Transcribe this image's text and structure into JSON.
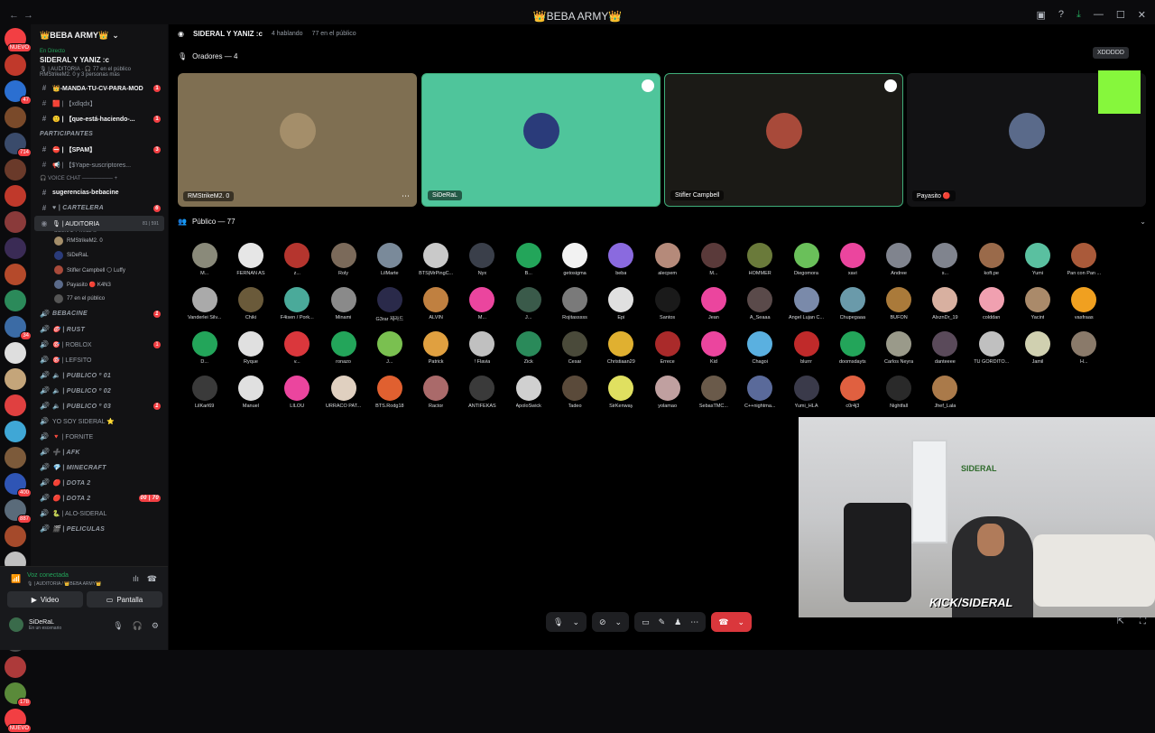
{
  "app": {
    "title": "👑BEBA ARMY👑"
  },
  "colors": {
    "accent": "#23a55a",
    "danger": "#da373c",
    "brand": "#5865f2"
  },
  "servers": [
    {
      "badge": "NUEVO",
      "color": "#f23f43"
    },
    {
      "badge": "",
      "color": "#c0392b"
    },
    {
      "badge": "47",
      "color": "#2b6fd1"
    },
    {
      "badge": "",
      "color": "#7a4a2a"
    },
    {
      "badge": "714",
      "color": "#3a4b6b"
    },
    {
      "badge": "",
      "color": "#6a3a2a"
    },
    {
      "badge": "",
      "color": "#c0392b"
    },
    {
      "badge": "",
      "color": "#8a3a3a"
    },
    {
      "badge": "",
      "color": "#3a2b55"
    },
    {
      "badge": "",
      "color": "#b54a2b"
    },
    {
      "badge": "",
      "color": "#2b8a5a"
    },
    {
      "badge": "34",
      "color": "#3b6ba5"
    },
    {
      "badge": "",
      "color": "#dedede"
    },
    {
      "badge": "",
      "color": "#c4a57a"
    },
    {
      "badge": "",
      "color": "#e04040"
    },
    {
      "badge": "",
      "color": "#3fa7d6"
    },
    {
      "badge": "",
      "color": "#7c5a3a"
    },
    {
      "badge": "400",
      "color": "#2f55b5"
    },
    {
      "badge": "887",
      "color": "#5a6b7a"
    },
    {
      "badge": "",
      "color": "#a54a2b"
    },
    {
      "badge": "",
      "color": "#c0c0c0"
    },
    {
      "badge": "173",
      "color": "#111"
    },
    {
      "badge": "",
      "color": "#e2a27a"
    },
    {
      "badge": "",
      "color": "#4a4a4a"
    },
    {
      "badge": "",
      "color": "#ad3a3a"
    },
    {
      "badge": "178",
      "color": "#5a8a3a"
    },
    {
      "badge": "NUEVO",
      "color": "#f23f43"
    }
  ],
  "sidebar": {
    "guild_name": "👑BEBA ARMY👑",
    "live": {
      "label": "En Directo",
      "title": "SIDERAL Y YANIZ :c",
      "meta": "🎙 | AUDITORIA · 🎧 77 en el público",
      "speakers": "RMStrikeM2. 0 y 3 personas más"
    },
    "channels": [
      {
        "icon": "#",
        "label": "👑-MANDA-TU-CV-PARA-MOD",
        "style": "bright",
        "count": "1"
      },
      {
        "icon": "#",
        "label": "🟥 | 【xdlqdx】",
        "style": "",
        "count": ""
      },
      {
        "icon": "#",
        "label": "🙂 | 【que-está-haciendo-...",
        "style": "bright",
        "count": "1"
      },
      {
        "icon": "",
        "label": "PARTICIPANTES",
        "style": "italic",
        "count": ""
      },
      {
        "icon": "#",
        "label": "⛔ | 【SPAM】",
        "style": "bright",
        "count": "3"
      },
      {
        "icon": "#",
        "label": "📢 | 【$Yape-suscriptores...",
        "style": "",
        "count": ""
      },
      {
        "icon": "",
        "label": "🎧 VOICE CHAT ──────── +",
        "style": "cat",
        "count": ""
      },
      {
        "icon": "#",
        "label": "sugerencias-bebacine",
        "style": "bright",
        "count": ""
      },
      {
        "icon": "#",
        "label": "♥ | CARTELERA",
        "style": "italic",
        "count": "6"
      }
    ],
    "active": {
      "label": "🎙 | AUDITORIA",
      "sub": "SIDERAL Y YANIZ :c",
      "meta": "81 | 591"
    },
    "stage_members": [
      "RMStrikeM2. 0",
      "SiDeRaL",
      "Stifler Campbell 🌕 Luffy",
      "Payasito 🔴 K4N3",
      "77 en el público"
    ],
    "channels2": [
      {
        "icon": "🔊",
        "label": "BEBACINE",
        "style": "italic",
        "count": "1"
      },
      {
        "icon": "🔊",
        "label": "🎯 | RUST",
        "style": "italic",
        "count": ""
      },
      {
        "icon": "🔊",
        "label": "🎯 | ROBLOX",
        "style": "",
        "count": "1"
      },
      {
        "icon": "🔊",
        "label": "🎯 | LEFSITO",
        "style": "",
        "count": ""
      },
      {
        "icon": "🔊",
        "label": "🔈 | PUBLICO º 01",
        "style": "italic",
        "count": ""
      },
      {
        "icon": "🔊",
        "label": "🔈 | PUBLICO º 02",
        "style": "italic",
        "count": ""
      },
      {
        "icon": "🔊",
        "label": "🔈 | PUBLICO º 03",
        "style": "italic",
        "count": "1"
      },
      {
        "icon": "🔊",
        "label": "YO SOY SIDERAL ⭐",
        "style": "",
        "count": ""
      },
      {
        "icon": "🔊",
        "label": "🔻 | FORNITE",
        "style": "",
        "count": ""
      },
      {
        "icon": "🔊",
        "label": "➕ | AFK",
        "style": "italic",
        "count": ""
      },
      {
        "icon": "🔊",
        "label": "💎 | MINECRAFT",
        "style": "italic",
        "count": ""
      },
      {
        "icon": "🔊",
        "label": "🔴 | DOTA 2",
        "style": "italic",
        "count": ""
      },
      {
        "icon": "🔊",
        "label": "🔴 | DOTA 2",
        "style": "italic",
        "count": "00 | 70"
      },
      {
        "icon": "🔊",
        "label": "🐍 | ALO-SIDERAL",
        "style": "",
        "count": ""
      },
      {
        "icon": "🔊",
        "label": "🎬 | PELICULAS",
        "style": "italic",
        "count": ""
      }
    ]
  },
  "voice": {
    "status": "Voz conectada",
    "location": "🎙 | AUDITORIA / 👑BEBA ARMY👑",
    "video_label": "Video",
    "screen_label": "Pantalla"
  },
  "user": {
    "name": "SiDeRaL",
    "status": "En un escenario"
  },
  "stage": {
    "title": "SIDERAL Y YANIZ :c",
    "speaking": "4 hablando",
    "audience_count": "77 en el público",
    "speakers_label": "Oradores — 4",
    "audience_label": "Público — 77",
    "speakers": [
      {
        "name": "RMStrikeM2. 0",
        "bg": "#7f6f52",
        "av": "#a48e6a"
      },
      {
        "name": "SiDeRaL",
        "bg": "#4fc59b",
        "av": "#2a3b7a"
      },
      {
        "name": "Stifler Campbell",
        "bg": "#1b1a16",
        "av": "#a84a3a"
      },
      {
        "name": "Payasito 🔴",
        "bg": "#121214",
        "av": "#5a6a8a"
      }
    ],
    "xd_label": "XDDDDD"
  },
  "audience": [
    {
      "n": "M...",
      "c": "#8a8a7a"
    },
    {
      "n": "FERNAN AS",
      "c": "#e6e6e6"
    },
    {
      "n": "z...",
      "c": "#b5352e"
    },
    {
      "n": "Roly",
      "c": "#7b6a5a"
    },
    {
      "n": "LilMarte",
      "c": "#7a8a9a"
    },
    {
      "n": "BTS|MrPingC...",
      "c": "#c9c9c9"
    },
    {
      "n": "Nyx",
      "c": "#3a3f4a"
    },
    {
      "n": "B...",
      "c": "#23a55a"
    },
    {
      "n": "getosigma",
      "c": "#f2f2f2"
    },
    {
      "n": "beba",
      "c": "#8a6adf"
    },
    {
      "n": "alecpem",
      "c": "#b58a7a"
    },
    {
      "n": "M...",
      "c": "#5a3a3a"
    },
    {
      "n": "HOMMER",
      "c": "#6a7a3a"
    },
    {
      "n": "Diegomora",
      "c": "#6ac05a"
    },
    {
      "n": "xavi",
      "c": "#eb459e"
    },
    {
      "n": "Andree",
      "c": "#80848e"
    },
    {
      "n": "s...",
      "c": "#80848e"
    },
    {
      "n": "koft.pe",
      "c": "#9a6a4a"
    },
    {
      "n": "Yumi",
      "c": "#5ac0a0"
    },
    {
      "n": "Pan con Pan ...",
      "c": "#aa5a3a"
    },
    {
      "n": "Vanderlei Silv...",
      "c": "#aaaaaa"
    },
    {
      "n": "Chiki",
      "c": "#6a5a3a"
    },
    {
      "n": "F4isen / Pork...",
      "c": "#4aaa9a"
    },
    {
      "n": "Minami",
      "c": "#8a8a8a"
    },
    {
      "n": "G3rar 제라드",
      "c": "#2a2a4a"
    },
    {
      "n": "ALVIN",
      "c": "#c08040"
    },
    {
      "n": "M...",
      "c": "#eb459e"
    },
    {
      "n": "J...",
      "c": "#3a5a4a"
    },
    {
      "n": "Rojitasssss",
      "c": "#7a7a7a"
    },
    {
      "n": "Epi",
      "c": "#e0e0e0"
    },
    {
      "n": "Santos",
      "c": "#1a1a1a"
    },
    {
      "n": "Jean",
      "c": "#eb459e"
    },
    {
      "n": "A_Seaaa",
      "c": "#5a4a4a"
    },
    {
      "n": "Angel Lujan C...",
      "c": "#7a8aaa"
    },
    {
      "n": "Chupegaaa",
      "c": "#6a9aaa"
    },
    {
      "n": "BUFON",
      "c": "#aa7a3a"
    },
    {
      "n": "AlxznDr_19",
      "c": "#d8b0a0"
    },
    {
      "n": "colddan",
      "c": "#f0a0b0"
    },
    {
      "n": "Yacint",
      "c": "#aa8a6a"
    },
    {
      "n": "vasfraas",
      "c": "#f0a020"
    },
    {
      "n": "D...",
      "c": "#23a55a"
    },
    {
      "n": "Ryque",
      "c": "#e0e0e0"
    },
    {
      "n": "v...",
      "c": "#da373c"
    },
    {
      "n": "ronazo",
      "c": "#23a55a"
    },
    {
      "n": "J...",
      "c": "#7ac050"
    },
    {
      "n": "Patrick",
      "c": "#e0a040"
    },
    {
      "n": "! Flavia",
      "c": "#c0c0c0"
    },
    {
      "n": "Zick",
      "c": "#2a8a5a"
    },
    {
      "n": "Cesar",
      "c": "#4a4a3a"
    },
    {
      "n": "Christiaan29",
      "c": "#e0b030"
    },
    {
      "n": "Errece",
      "c": "#aa2a2a"
    },
    {
      "n": "Kid",
      "c": "#eb459e"
    },
    {
      "n": "Chagoi",
      "c": "#5ab0e0"
    },
    {
      "n": "blurrr",
      "c": "#c02a2a"
    },
    {
      "n": "doomsdayts",
      "c": "#23a55a"
    },
    {
      "n": "Carlos Neyra",
      "c": "#9a9a8a"
    },
    {
      "n": "danteeee",
      "c": "#5a4a5a"
    },
    {
      "n": "TU GORDITO...",
      "c": "#c0c0c0"
    },
    {
      "n": "Jamil",
      "c": "#d0d0b0"
    },
    {
      "n": "H...",
      "c": "#8a7a6a"
    },
    {
      "n": "LilKarl69",
      "c": "#3a3a3a"
    },
    {
      "n": "Manuel",
      "c": "#e0e0e0"
    },
    {
      "n": "LILOU",
      "c": "#eb459e"
    },
    {
      "n": "URRACO PAT...",
      "c": "#e0d0c0"
    },
    {
      "n": "BTS.Rodg18",
      "c": "#e06030"
    },
    {
      "n": "Ractor",
      "c": "#aa6a6a"
    },
    {
      "n": "ANTIFEKAS",
      "c": "#3a3a3a"
    },
    {
      "n": "ApoloSwick",
      "c": "#d0d0d0"
    },
    {
      "n": "Tadeo",
      "c": "#5a4a3a"
    },
    {
      "n": "SirKenway",
      "c": "#e0e060"
    },
    {
      "n": "yolamao",
      "c": "#c0a0a0"
    },
    {
      "n": "SebasTMC...",
      "c": "#6a5a4a"
    },
    {
      "n": "C++nightma...",
      "c": "#5a6a9a"
    },
    {
      "n": "Yumi_HLA",
      "c": "#3a3a4a"
    },
    {
      "n": "c0r4j3",
      "c": "#e06040"
    },
    {
      "n": "Nightfall",
      "c": "#2a2a2a"
    },
    {
      "n": "Jhef_Lala",
      "c": "#aa7a4a"
    }
  ],
  "stream": {
    "overlay_text": "KICK/SIDERAL",
    "logo_text": "SIDERAL"
  }
}
